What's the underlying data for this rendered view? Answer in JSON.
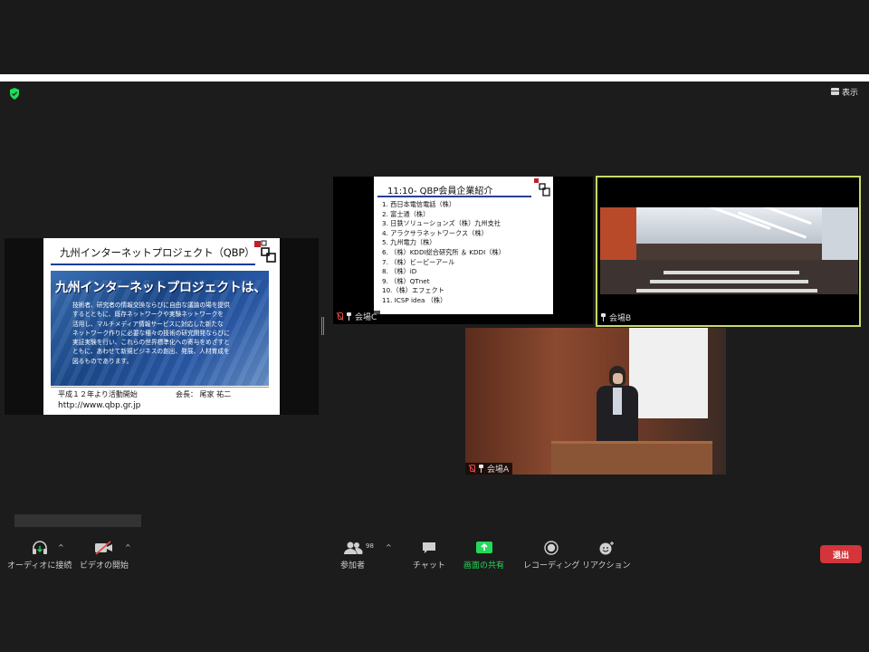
{
  "top_right": {
    "view_label": "表示"
  },
  "shared_slide": {
    "title": "九州インターネットプロジェクト（QBP）",
    "heading": "九州インターネットプロジェクトは、",
    "body_lines": [
      "技術者、研究者の情報交換ならびに自由な議論の場を提供",
      "するとともに、既存ネットワークや実験ネットワークを",
      "活用し、マルチメディア情報サービスに対応した新たな",
      "ネットワーク作りに必要な種々の技術の研究開発ならびに",
      "実証実験を行い、これらの世界標準化への寄与をめざすと",
      "ともに、あわせて新規ビジネスの創出、発展、人材育成を",
      "図るものであります。"
    ],
    "since": "平成１２年より活動開始",
    "president": "会長：  尾家 祐二",
    "url": "http://www.qbp.gr.jp"
  },
  "tiles": {
    "c": {
      "name": "会場C",
      "slide_title": "11:10- QBP会員企業紹介",
      "members": [
        "1. 西日本電信電話（株）",
        "2. 富士通（株）",
        "3. 日鉄ソリューションズ（株）九州支社",
        "4. アラクサラネットワークス（株）",
        "5. 九州電力（株）",
        "6. （株）KDDI総合研究所 ＆ KDDI（株）",
        "7. （株）ビービーアール",
        "8. （株）iD",
        "9. （株）QTnet",
        "10.（株）エフェクト",
        "11. ICSP idea （株）"
      ]
    },
    "b": {
      "name": "会場B"
    },
    "a": {
      "name": "会場A"
    }
  },
  "toolbar": {
    "audio": "オーディオに接続",
    "video": "ビデオの開始",
    "participants": "参加者",
    "participants_count": "98",
    "chat": "チャット",
    "share": "画面の共有",
    "record": "レコーディング",
    "reactions": "リアクション",
    "leave": "退出"
  },
  "colors": {
    "share_green": "#23d959",
    "leave_red": "#d3353a",
    "active_border": "#c9d96a"
  }
}
